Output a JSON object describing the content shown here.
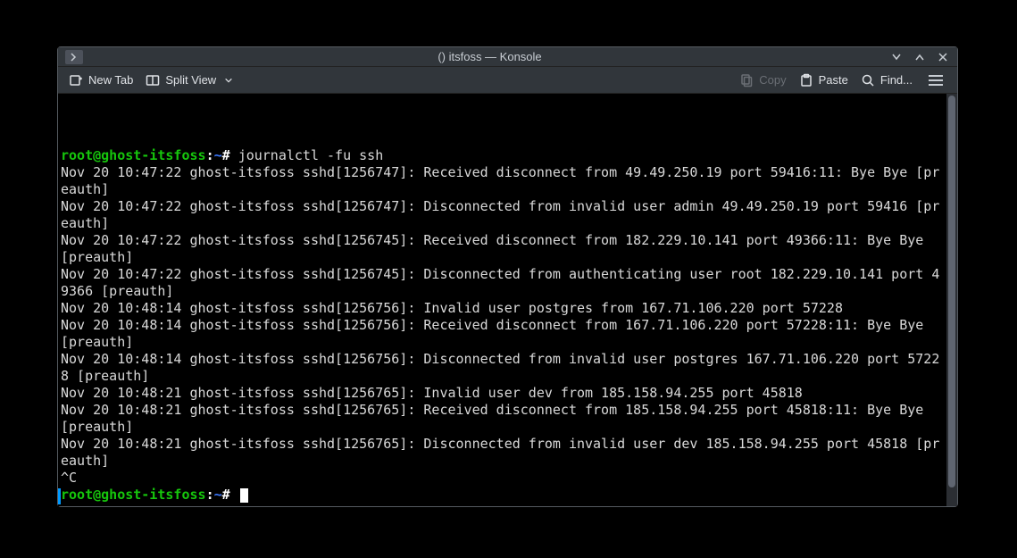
{
  "titlebar": {
    "title": "() itsfoss — Konsole"
  },
  "toolbar": {
    "new_tab": "New Tab",
    "split_view": "Split View",
    "copy": "Copy",
    "paste": "Paste",
    "find": "Find..."
  },
  "prompt": {
    "user_host": "root@ghost-itsfoss",
    "sep": ":",
    "path": "~",
    "sigil": "#"
  },
  "command": "journalctl -fu ssh",
  "output_lines": [
    "Nov 20 10:47:22 ghost-itsfoss sshd[1256747]: Received disconnect from 49.49.250.19 port 59416:11: Bye Bye [preauth]",
    "Nov 20 10:47:22 ghost-itsfoss sshd[1256747]: Disconnected from invalid user admin 49.49.250.19 port 59416 [preauth]",
    "Nov 20 10:47:22 ghost-itsfoss sshd[1256745]: Received disconnect from 182.229.10.141 port 49366:11: Bye Bye [preauth]",
    "Nov 20 10:47:22 ghost-itsfoss sshd[1256745]: Disconnected from authenticating user root 182.229.10.141 port 49366 [preauth]",
    "Nov 20 10:48:14 ghost-itsfoss sshd[1256756]: Invalid user postgres from 167.71.106.220 port 57228",
    "Nov 20 10:48:14 ghost-itsfoss sshd[1256756]: Received disconnect from 167.71.106.220 port 57228:11: Bye Bye [preauth]",
    "Nov 20 10:48:14 ghost-itsfoss sshd[1256756]: Disconnected from invalid user postgres 167.71.106.220 port 57228 [preauth]",
    "Nov 20 10:48:21 ghost-itsfoss sshd[1256765]: Invalid user dev from 185.158.94.255 port 45818",
    "Nov 20 10:48:21 ghost-itsfoss sshd[1256765]: Received disconnect from 185.158.94.255 port 45818:11: Bye Bye [preauth]",
    "Nov 20 10:48:21 ghost-itsfoss sshd[1256765]: Disconnected from invalid user dev 185.158.94.255 port 45818 [preauth]",
    "^C"
  ]
}
